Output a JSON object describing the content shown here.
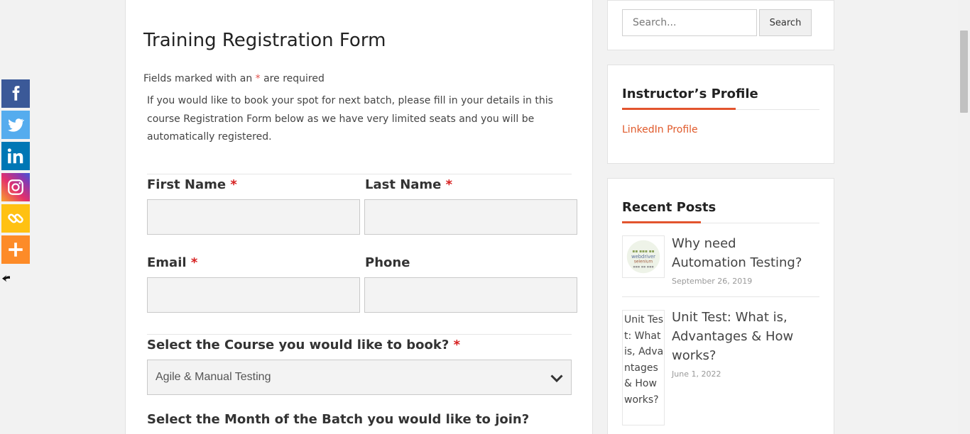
{
  "share": {
    "buttons": [
      {
        "name": "facebook",
        "color": "#3b5998"
      },
      {
        "name": "twitter",
        "color": "#55acee"
      },
      {
        "name": "linkedin",
        "color": "#0077b5"
      },
      {
        "name": "instagram",
        "color": "#c13584"
      },
      {
        "name": "copy-link",
        "color": "#ffc112"
      },
      {
        "name": "more",
        "color": "#fd8b28"
      }
    ]
  },
  "form": {
    "title": "Training Registration Form",
    "required_prefix": "Fields marked with an ",
    "required_star": "*",
    "required_suffix": " are required",
    "intro": "If you would like to book your spot for next batch, please fill in your details in this course Registration Form below as we have very limited seats and you will be automatically registered.",
    "first_name_label": "First Name",
    "last_name_label": "Last Name",
    "email_label": "Email",
    "phone_label": "Phone",
    "course_label": "Select the Course you would like to book?",
    "course_selected": "Agile & Manual Testing",
    "month_label": "Select the Month of the Batch you would like to join?",
    "star": "*"
  },
  "sidebar": {
    "search_placeholder": "Search...",
    "search_button": "Search",
    "profile_title": "Instructor’s Profile",
    "profile_link": "LinkedIn Profile",
    "posts_title": "Recent Posts",
    "posts": [
      {
        "title": "Why need Automation Testing?",
        "date": "September 26, 2019"
      },
      {
        "title": "Unit Test: What is, Advantages & How works?",
        "date": "June 1, 2022",
        "thumb_alt": "Unit Test: What is, Advantages & How works?"
      }
    ]
  },
  "colors": {
    "accent": "#e2542e",
    "required": "#d61f1f"
  }
}
